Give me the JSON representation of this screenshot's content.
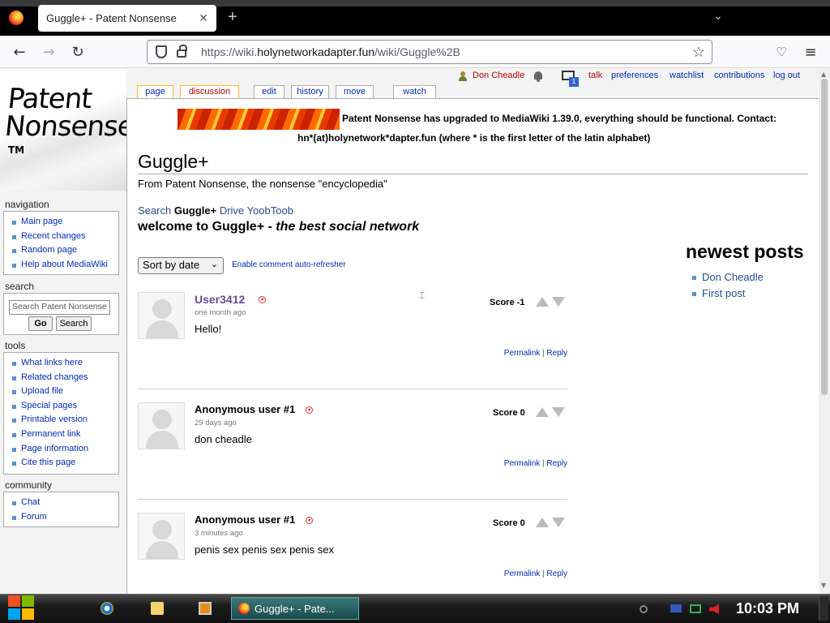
{
  "browser": {
    "tab_title": "Guggle+ - Patent Nonsense",
    "tab_close": "✕",
    "new_tab": "+",
    "url_prefix": "https://wiki.",
    "url_domain": "holynetworkadapter.fun",
    "url_path": "/wiki/Guggle%2B"
  },
  "site": {
    "logo_text": "Patent Nonsense",
    "logo_tm": "TM",
    "notice_line1": "Patent Nonsense has upgraded to MediaWiki 1.39.0, everything should be functional. Contact:",
    "notice_line2": "hn*(at)holynetwork*dapter.fun (where * is the first letter of the latin alphabet)"
  },
  "personal_tools": {
    "username": "Don Cheadle",
    "notif_count": "1",
    "talk": "talk",
    "preferences": "preferences",
    "watchlist": "watchlist",
    "contributions": "contributions",
    "logout": "log out"
  },
  "content_tabs": {
    "page": "page",
    "discussion": "discussion",
    "edit": "edit",
    "history": "history",
    "move": "move",
    "watch": "watch"
  },
  "sidebar": {
    "navigation": {
      "title": "navigation",
      "items": [
        "Main page",
        "Recent changes",
        "Random page",
        "Help about MediaWiki"
      ]
    },
    "search": {
      "title": "search",
      "placeholder": "Search Patent Nonsense",
      "go": "Go",
      "search": "Search"
    },
    "tools": {
      "title": "tools",
      "items": [
        "What links here",
        "Related changes",
        "Upload file",
        "Special pages",
        "Printable version",
        "Permanent link",
        "Page information",
        "Cite this page"
      ]
    },
    "community": {
      "title": "community",
      "items": [
        "Chat",
        "Forum"
      ]
    }
  },
  "article": {
    "title": "Guggle+",
    "subtitle": "From Patent Nonsense, the nonsense \"encyclopedia\"",
    "nav_search": "Search",
    "nav_current": "Guggle+",
    "nav_drive": "Drive",
    "nav_yoobtoob": "YoobToob",
    "welcome_bold": "welcome to Guggle+ - ",
    "welcome_italic": "the best social network",
    "sort_value": "Sort by date",
    "refresher": "Enable comment auto-refresher",
    "newest_title": "newest posts",
    "newest_posts": [
      "Don Cheadle",
      "First post"
    ]
  },
  "comments": [
    {
      "user": "User3412",
      "time": "one month ago",
      "text": "Hello!",
      "score": "Score -1",
      "permalink": "Permalink",
      "reply": "Reply"
    },
    {
      "user": "Anonymous user #1",
      "time": "29 days ago",
      "text": "don cheadle",
      "score": "Score 0",
      "permalink": "Permalink",
      "reply": "Reply"
    },
    {
      "user": "Anonymous user #1",
      "time": "3 minutes ago",
      "text": "penis sex penis sex penis sex",
      "score": "Score 0",
      "permalink": "Permalink",
      "reply": "Reply"
    }
  ],
  "taskbar": {
    "task_label": "Guggle+ - Pate...",
    "clock": "10:03 PM"
  },
  "colors": {
    "link": "#002bb8",
    "selected_tab_border": "#fabd23",
    "new_link": "#ba0000"
  }
}
